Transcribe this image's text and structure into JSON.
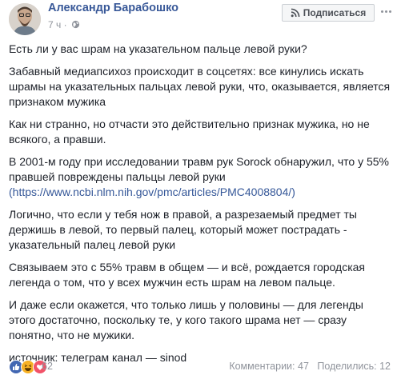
{
  "author": {
    "name": "Александр Барабошко",
    "time": "7 ч"
  },
  "header": {
    "subscribe_label": "Подписаться"
  },
  "post": {
    "paragraphs": [
      "Есть ли у вас шрам на указательном пальце левой руки?",
      "Забавный медиапсихоз происходит в соцсетях: все кинулись искать шрамы на указательных пальцах левой руки, что, оказывается, является признаком мужика",
      "Как ни странно, но отчасти это действительно признак мужика, но не всякого, а правши.",
      "В 2001-м году при исследовании травм рук Sorock обнаружил, что у 55% правшей повреждены пальцы левой руки",
      "Логично, что если у тебя нож в правой, а разрезаемый предмет ты держишь в левой, то первый палец, который может пострадать - указательный палец левой руки",
      "Связываем это с 55% травм в общем — и всё, рождается городская легенда о том, что у всех мужчин есть шрам на левом пальце.",
      "И даже если окажется, что только лишь у половины — для легенды этого достаточно, поскольку те, у кого такого шрама нет — сразу понятно, что не мужики.",
      "источник: телеграм канал — sinod"
    ],
    "link": "(https://www.ncbi.nlm.nih.gov/pmc/articles/PMC4008804/)"
  },
  "footer": {
    "reaction_count": "62",
    "comments": "Комментарии: 47",
    "shares": "Поделились: 12"
  },
  "icons": [
    "avatar",
    "globe-icon",
    "rss-icon",
    "more-icon",
    "like-reaction-icon",
    "haha-reaction-icon",
    "love-reaction-icon"
  ],
  "colors": {
    "author_link": "#385898",
    "link": "#365899",
    "meta": "#90949c",
    "like": "#4267b2",
    "haha": "#f7b125",
    "love": "#f25268"
  }
}
